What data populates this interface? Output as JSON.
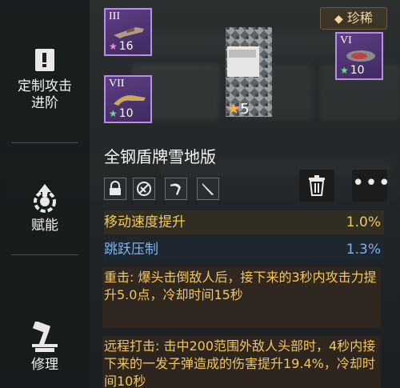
{
  "sidebar": {
    "items": [
      {
        "label": "定制攻击\n进阶"
      },
      {
        "label": "赋能"
      },
      {
        "label": "修理"
      }
    ]
  },
  "rarity": {
    "label": "珍稀",
    "icon": "diamond-icon",
    "color": "#f3d79b"
  },
  "parts": [
    {
      "roman": "III",
      "level": "16",
      "star_color": "#ff7fd8"
    },
    {
      "roman": "VII",
      "level": "10",
      "star_color": "#68e08a"
    },
    {
      "roman": "VI",
      "level": "10",
      "star_color": "#68e08a"
    }
  ],
  "item": {
    "name": "全钢盾牌雪地版",
    "count": "5"
  },
  "stats": [
    {
      "name": "移动速度提升",
      "value": "1.0%",
      "color": "#f2c75a"
    },
    {
      "name": "跳跃压制",
      "value": "1.3%",
      "color": "#7fb2f0"
    }
  ],
  "descriptions": [
    {
      "text": "重击: 爆头击倒敌人后，接下来的3秒内攻击力提升5.0点，冷却时间15秒"
    },
    {
      "text": "远程打击: 击中200范围外敌人头部时，4秒内接下来的一发子弹造成的伤害提升19.4%，冷却时间10秒"
    }
  ]
}
